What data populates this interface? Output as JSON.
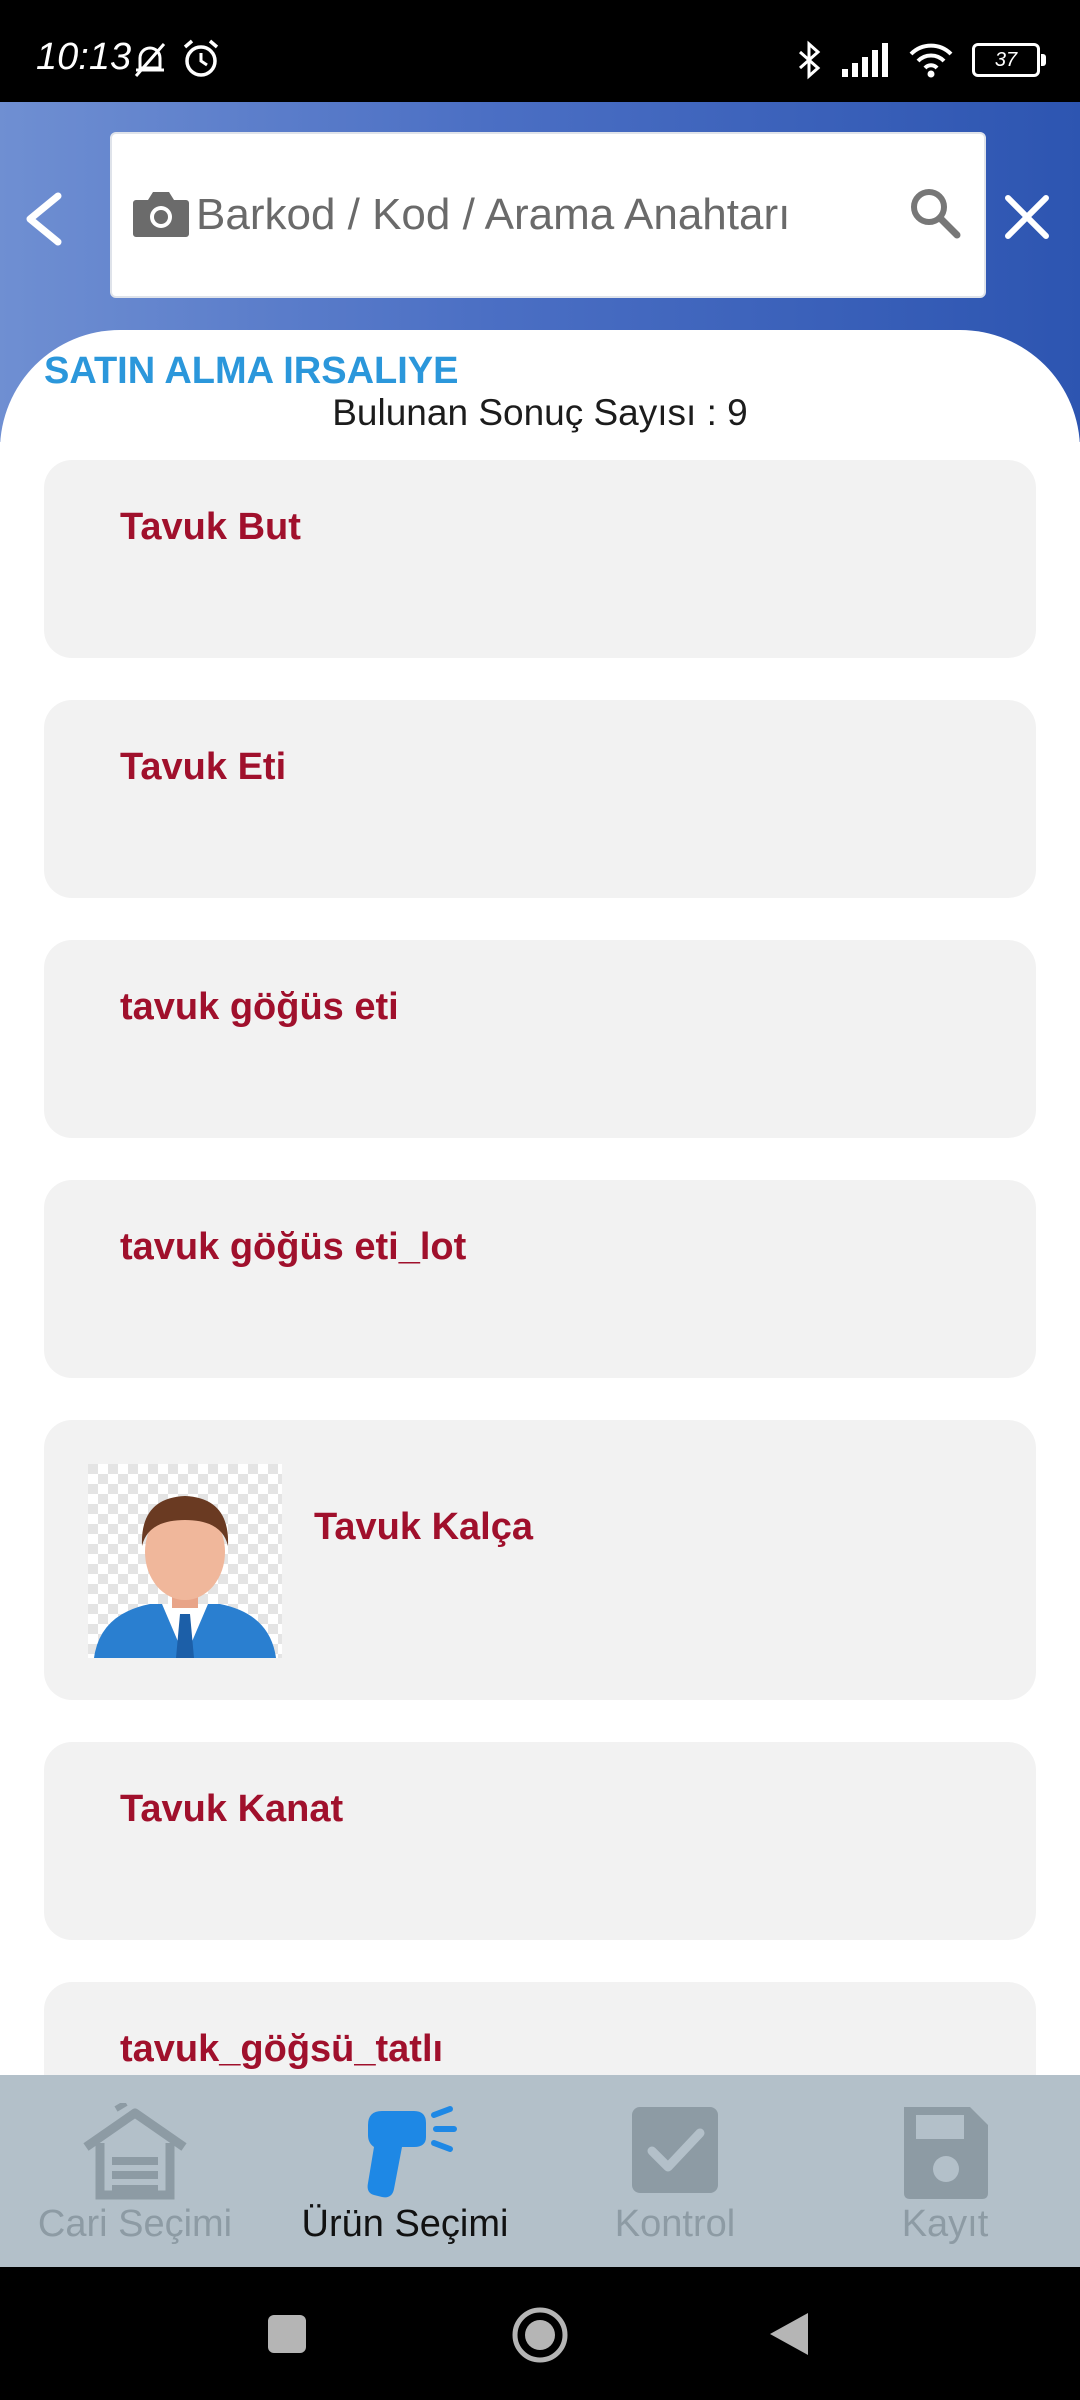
{
  "status_bar": {
    "time": "10:13",
    "battery": "37"
  },
  "header": {
    "search_placeholder": "Barkod / Kod / Arama Anahtarı"
  },
  "page": {
    "title": "SATIN ALMA IRSALIYE",
    "result_count": "Bulunan Sonuç Sayısı : 9"
  },
  "products": [
    {
      "label": "Tavuk But"
    },
    {
      "label": "Tavuk Eti"
    },
    {
      "label": "tavuk göğüs eti"
    },
    {
      "label": "tavuk göğüs eti_lot"
    },
    {
      "label": "Tavuk Kalça",
      "has_image": true
    },
    {
      "label": "Tavuk Kanat"
    },
    {
      "label": "tavuk_göğsü_tatlı"
    }
  ],
  "bottom_nav": [
    {
      "label": "Cari Seçimi",
      "icon": "warehouse-icon",
      "active": false
    },
    {
      "label": "Ürün Seçimi",
      "icon": "barcode-scanner-icon",
      "active": true
    },
    {
      "label": "Kontrol",
      "icon": "check-box-icon",
      "active": false
    },
    {
      "label": "Kayıt",
      "icon": "save-icon",
      "active": false
    }
  ],
  "colors": {
    "accent": "#2b97db",
    "product_label": "#a0102c",
    "header_start": "#6f8fd2",
    "header_end": "#2d55b1",
    "active_nav_icon": "#1e88e5"
  }
}
